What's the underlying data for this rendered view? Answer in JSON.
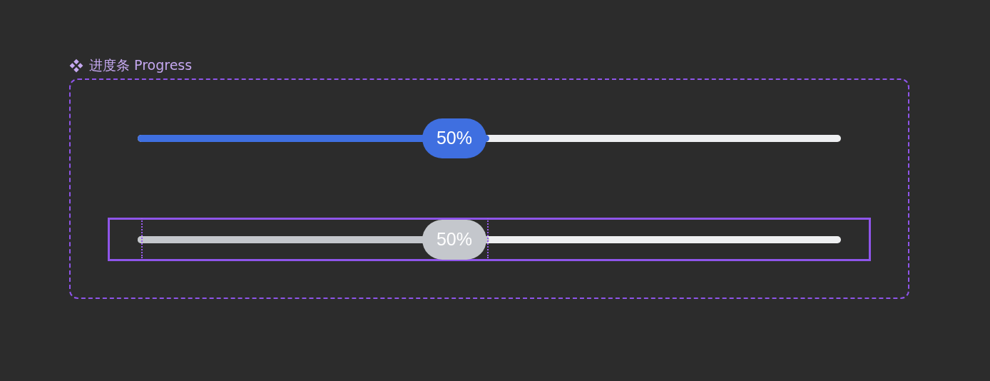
{
  "frame": {
    "label": "进度条 Progress"
  },
  "progress_bars": [
    {
      "level": 0.5,
      "reading": "50%",
      "disabled": false,
      "selected": false
    },
    {
      "level": 0.5,
      "reading": "50%",
      "disabled": true,
      "selected": true
    }
  ]
}
